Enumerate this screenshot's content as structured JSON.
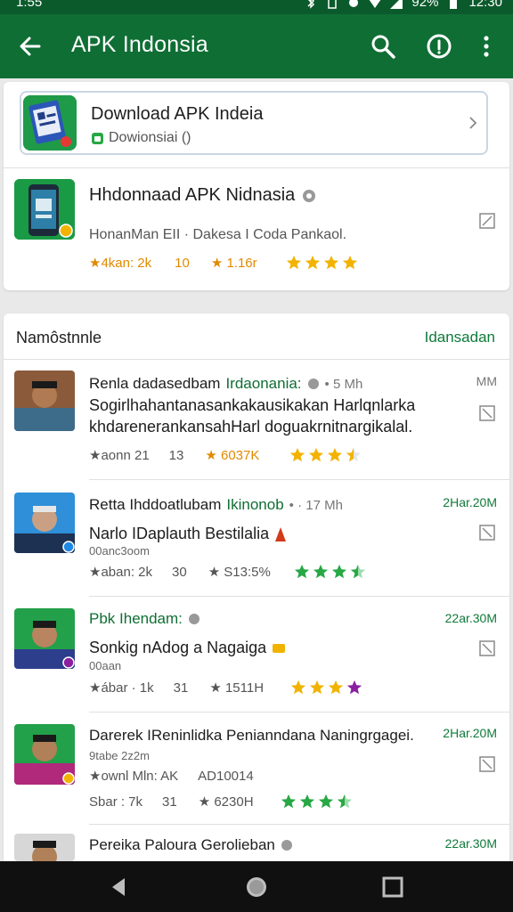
{
  "status": {
    "time": "1:55",
    "battery": "92%",
    "clock": "12:30"
  },
  "appbar": {
    "title": "APK Indonsia"
  },
  "featured": {
    "name": "Download APK Indeia",
    "sub": "Dowionsiai ()"
  },
  "app": {
    "name": "Hhdonnaad APK Nidnasia",
    "desc": "HonanMan EII · Dakesa I Coda Pankaol.",
    "rating_label": "★4kan: 2k",
    "count": "10",
    "score": "★ 1.16r",
    "stars": 4
  },
  "reviews_section": {
    "title": "Namôstnnle",
    "link": "Idansadan"
  },
  "reviews": [
    {
      "name": "Renla dadasedbam",
      "name2": "Irdaonania:",
      "extra": "• 5 Mh",
      "date": "MM",
      "body": "Sogirlhahantanasankakausikakan Harlqnlarka khdarenerankansahHarl doguakrnitnargikalal.",
      "small": "",
      "meta1": "★aonn 21",
      "meta2": "13",
      "score": "★ 6037K",
      "stars": 4,
      "star_color": "#f2b300",
      "last_color": "#f2b300",
      "half": true
    },
    {
      "name": "Retta Ihddoatlubam",
      "name2": "Ikinonob",
      "extra": "• · 17 Mh",
      "date": "2Har.20M",
      "headline": "Narlo IDaplauth Bestilalia",
      "small": "00anc3oom",
      "meta1": "★aban: 2k",
      "meta2": "30",
      "score": "★ S13:5%",
      "stars": 4,
      "star_color": "#27a844",
      "last_color": "#27a844",
      "half": true
    },
    {
      "name": "Pbk Ihendam:",
      "name2": "",
      "extra": "",
      "date": "22ar.30M",
      "headline": "Sonkig nAdog a Nagaiga",
      "small": "00aan",
      "meta1": "★ábar · 1k",
      "meta2": "31",
      "score": "★ 1511H",
      "stars": 4,
      "star_color": "#f2b300",
      "last_color": "#8a1fa0",
      "half": false
    },
    {
      "name": "Darerek IReninlidka Penianndana Naningrgagei.",
      "name2": "",
      "extra": "",
      "date": "2Har.20M",
      "headline": "",
      "small": "9tabe 2z2m",
      "meta0": "★ownl Mln: AK",
      "meta0b": "AD10014",
      "meta1": "Sbar : 7k",
      "meta2": "31",
      "score": "★ 6230H",
      "stars": 4,
      "star_color": "#27a844",
      "last_color": "#27a844",
      "half": true
    },
    {
      "name": "Pereika Paloura Gerolieban",
      "name2": "",
      "extra": "",
      "date": "22ar.30M"
    }
  ]
}
